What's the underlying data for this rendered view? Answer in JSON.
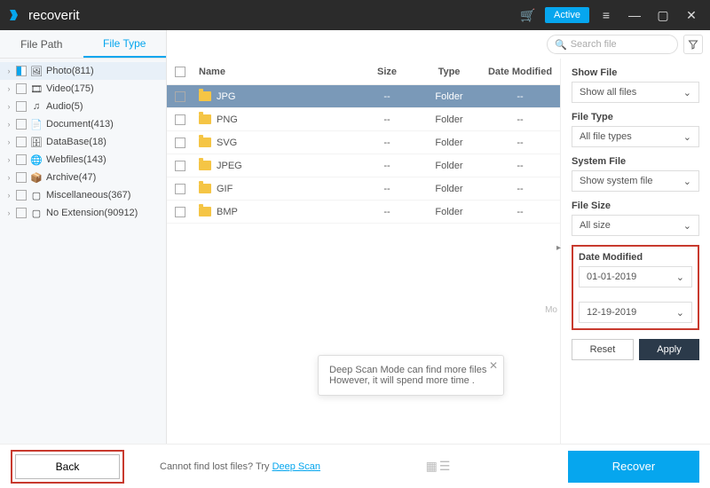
{
  "app": {
    "name": "recoverit",
    "active_btn": "Active"
  },
  "tabs": {
    "path": "File Path",
    "type": "File Type"
  },
  "tree": [
    {
      "label": "Photo(811)",
      "icon": "image",
      "active": true
    },
    {
      "label": "Video(175)",
      "icon": "film"
    },
    {
      "label": "Audio(5)",
      "icon": "music"
    },
    {
      "label": "Document(413)",
      "icon": "doc"
    },
    {
      "label": "DataBase(18)",
      "icon": "db"
    },
    {
      "label": "Webfiles(143)",
      "icon": "web"
    },
    {
      "label": "Archive(47)",
      "icon": "arc"
    },
    {
      "label": "Miscellaneous(367)",
      "icon": "misc"
    },
    {
      "label": "No Extension(90912)",
      "icon": "none"
    }
  ],
  "search": {
    "placeholder": "Search file"
  },
  "columns": {
    "name": "Name",
    "size": "Size",
    "type": "Type",
    "date": "Date Modified"
  },
  "rows": [
    {
      "name": "JPG",
      "size": "--",
      "type": "Folder",
      "date": "--",
      "sel": true
    },
    {
      "name": "PNG",
      "size": "--",
      "type": "Folder",
      "date": "--"
    },
    {
      "name": "SVG",
      "size": "--",
      "type": "Folder",
      "date": "--"
    },
    {
      "name": "JPEG",
      "size": "--",
      "type": "Folder",
      "date": "--"
    },
    {
      "name": "GIF",
      "size": "--",
      "type": "Folder",
      "date": "--"
    },
    {
      "name": "BMP",
      "size": "--",
      "type": "Folder",
      "date": "--"
    }
  ],
  "panel": {
    "show_file": {
      "label": "Show File",
      "value": "Show all files"
    },
    "file_type": {
      "label": "File Type",
      "value": "All file types"
    },
    "system_file": {
      "label": "System File",
      "value": "Show system file"
    },
    "file_size": {
      "label": "File Size",
      "value": "All size"
    },
    "date_modified": {
      "label": "Date Modified",
      "from": "01-01-2019",
      "to": "12-19-2019"
    },
    "reset": "Reset",
    "apply": "Apply"
  },
  "footer": {
    "back": "Back",
    "tooltip": "Deep Scan Mode can find more files However, it will spend more time .",
    "deep_prefix": "Cannot find lost files? Try ",
    "deep_link": "Deep Scan",
    "recover": "Recover",
    "ml": "Mo"
  }
}
